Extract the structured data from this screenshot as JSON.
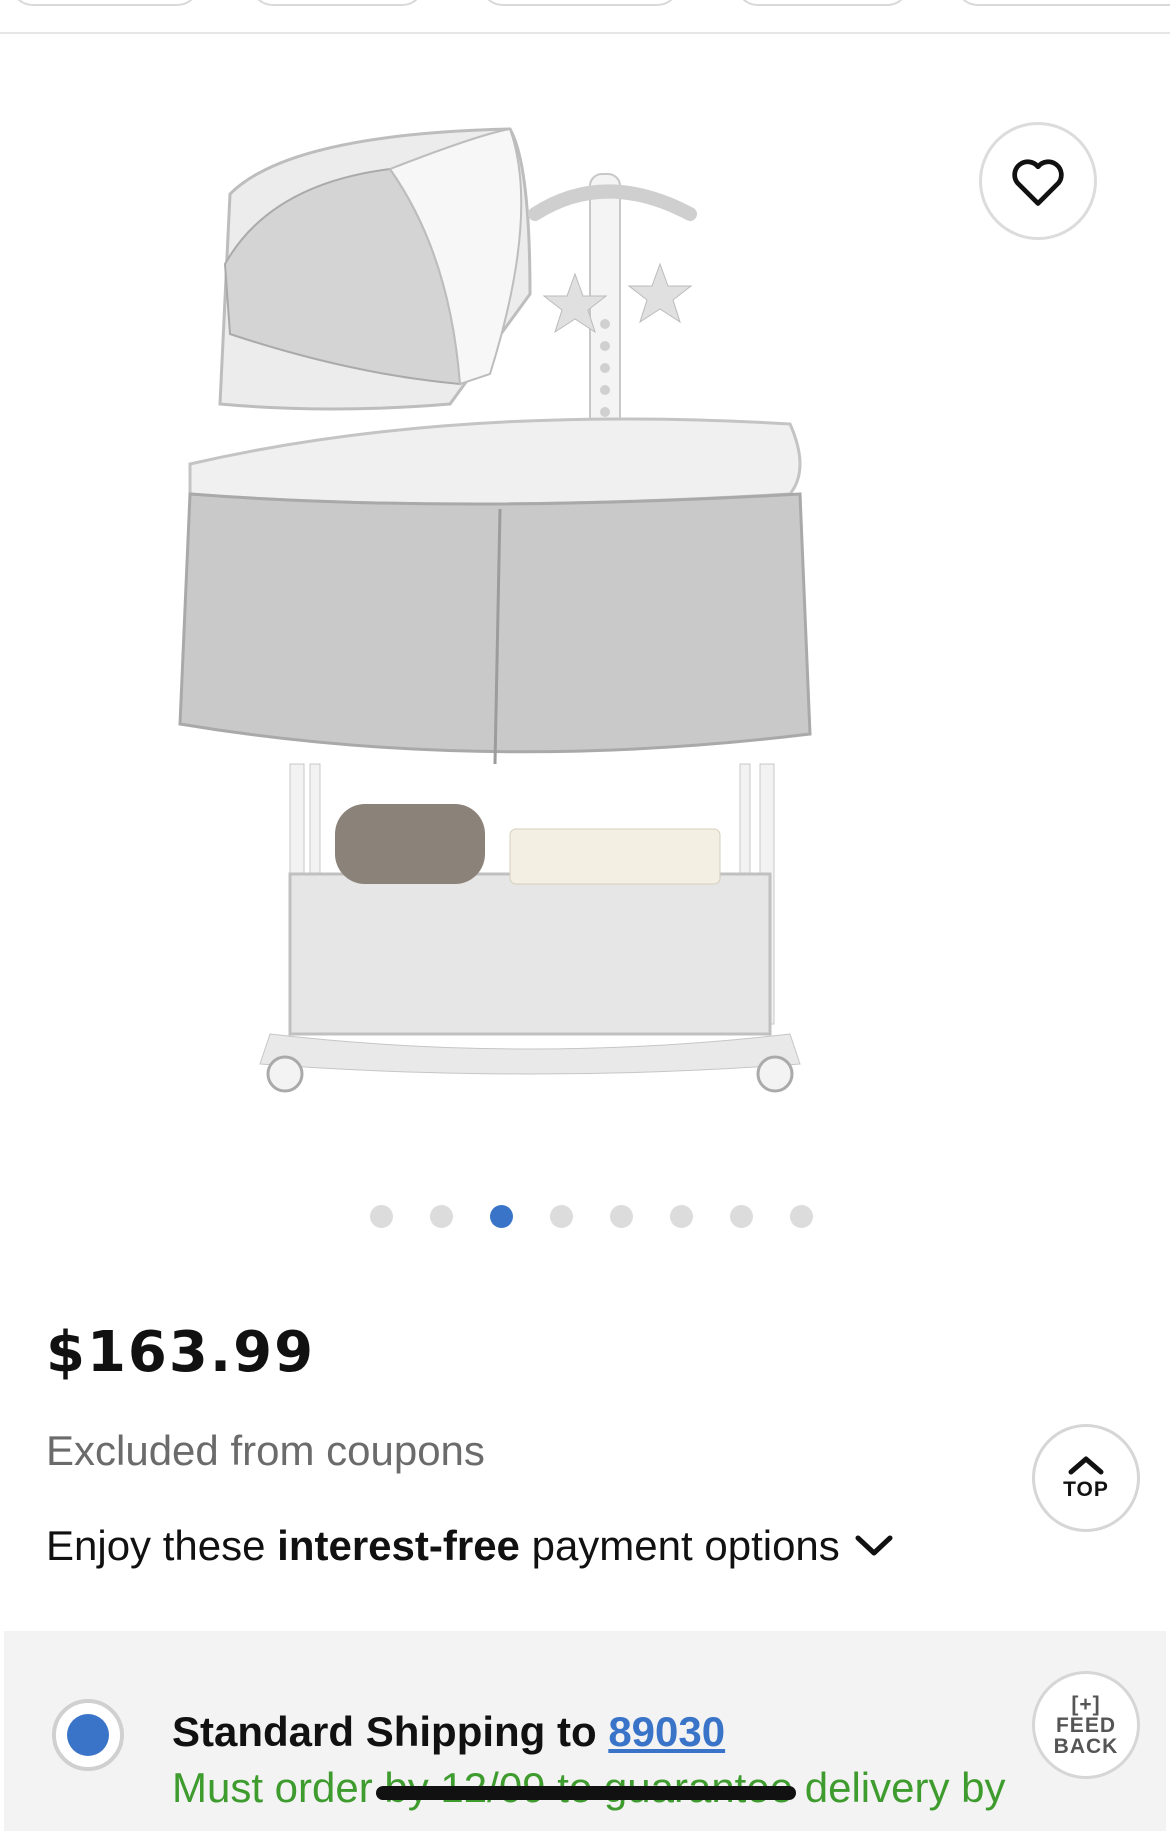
{
  "gallery": {
    "image_alt": "Bassinet product photo",
    "slide_count": 8,
    "active_slide": 3
  },
  "product": {
    "price": "$163.99",
    "coupon_note": "Excluded from coupons",
    "payment_prefix": "Enjoy these ",
    "payment_bold": "interest-free",
    "payment_suffix": " payment options"
  },
  "buttons": {
    "top_label": "TOP",
    "feedback_line1": "[+]",
    "feedback_line2": "FEED",
    "feedback_line3": "BACK"
  },
  "shipping": {
    "title": "Standard Shipping to",
    "zip": "89030",
    "note": "Must order by 12/09 to guarantee delivery by"
  },
  "colors": {
    "accent": "#3a74c8",
    "success": "#3e9b2e"
  },
  "icons": [
    "heart-icon",
    "chevron-down-icon",
    "chevron-up-icon"
  ]
}
